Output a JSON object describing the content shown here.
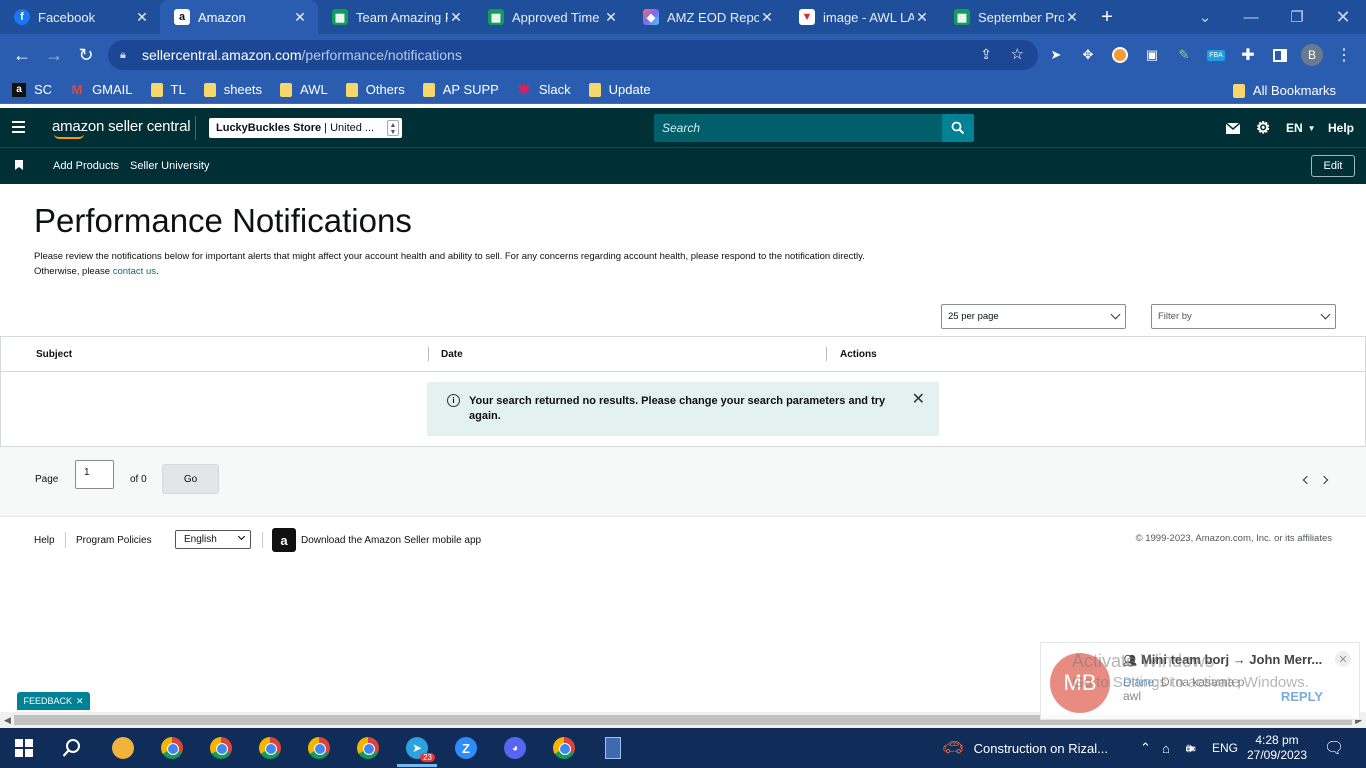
{
  "browser": {
    "tabs": [
      {
        "title": "Facebook",
        "icon": "facebook-icon",
        "color": "#1877f2",
        "glyph": "f",
        "active": false
      },
      {
        "title": "Amazon",
        "icon": "amazon-icon",
        "color": "#222222",
        "glyph": "a",
        "active": true
      },
      {
        "title": "Team Amazing P",
        "icon": "sheets-icon",
        "color": "#0f9d58",
        "glyph": "",
        "active": false
      },
      {
        "title": "Approved Time",
        "icon": "sheets-icon",
        "color": "#0f9d58",
        "glyph": "",
        "active": false
      },
      {
        "title": "AMZ EOD Repor",
        "icon": "clickup-icon",
        "color": "#7b68ee",
        "glyph": "",
        "active": false
      },
      {
        "title": "image - AWL LA",
        "icon": "trello-icon",
        "color": "#d32f2f",
        "glyph": "",
        "active": false
      },
      {
        "title": "September Profi",
        "icon": "sheets-icon",
        "color": "#0f9d58",
        "glyph": "",
        "active": false
      }
    ],
    "url_domain": "sellercentral.amazon.com",
    "url_path": "/performance/notifications",
    "profile_initial": "B",
    "fba_badge": "FBA",
    "bookmarks": [
      {
        "label": "SC",
        "icon": "amazon-icon"
      },
      {
        "label": "GMAIL",
        "icon": "gmail-icon"
      },
      {
        "label": "TL",
        "icon": "folder-icon"
      },
      {
        "label": "sheets",
        "icon": "folder-icon"
      },
      {
        "label": "AWL",
        "icon": "folder-icon"
      },
      {
        "label": "Others",
        "icon": "folder-icon"
      },
      {
        "label": "AP SUPP",
        "icon": "folder-icon"
      },
      {
        "label": "Slack",
        "icon": "slack-icon"
      },
      {
        "label": "Update",
        "icon": "folder-icon"
      }
    ],
    "all_bookmarks": "All Bookmarks"
  },
  "header": {
    "logo": "amazon seller central",
    "store_name": "LuckyBuckles Store",
    "store_region": "| United ...",
    "search_placeholder": "Search",
    "lang": "EN",
    "help": "Help"
  },
  "subnav": {
    "items": [
      "Add Products",
      "Seller University"
    ],
    "edit": "Edit"
  },
  "main": {
    "title": "Performance Notifications",
    "description": "Please review the notifications below for important alerts that might affect your account health and ability to sell. For any concerns regarding account health, please respond to the notification directly. Otherwise, please ",
    "contact_link": "contact us",
    "description_end": ".",
    "per_page": "25 per page",
    "filter": "Filter by",
    "columns": [
      "Subject",
      "Date",
      "Actions"
    ],
    "alert": "Your search returned no results. Please change your search parameters and try again."
  },
  "pager": {
    "page_label": "Page",
    "page_value": "1",
    "of_label": "of 0",
    "go": "Go"
  },
  "footer": {
    "help": "Help",
    "policies": "Program Policies",
    "language": "English",
    "app_text": "Download the Amazon Seller mobile app",
    "copyright": "© 1999-2023, Amazon.com, Inc. or its affiliates"
  },
  "feedback": "FEEDBACK",
  "toast": {
    "avatar": "MB",
    "title": "Mini team borj → John Merr...",
    "sender": "Diane:",
    "message": "Di na kasama p",
    "message2": "awl",
    "reply": "REPLY"
  },
  "watermark": {
    "line1": "Activate Windows",
    "line2": "Go to Settings to activate Windows."
  },
  "taskbar": {
    "telegram_badge": "23",
    "notification": "Construction on Rizal...",
    "lang": "ENG",
    "time": "4:28 pm",
    "date": "27/09/2023"
  }
}
